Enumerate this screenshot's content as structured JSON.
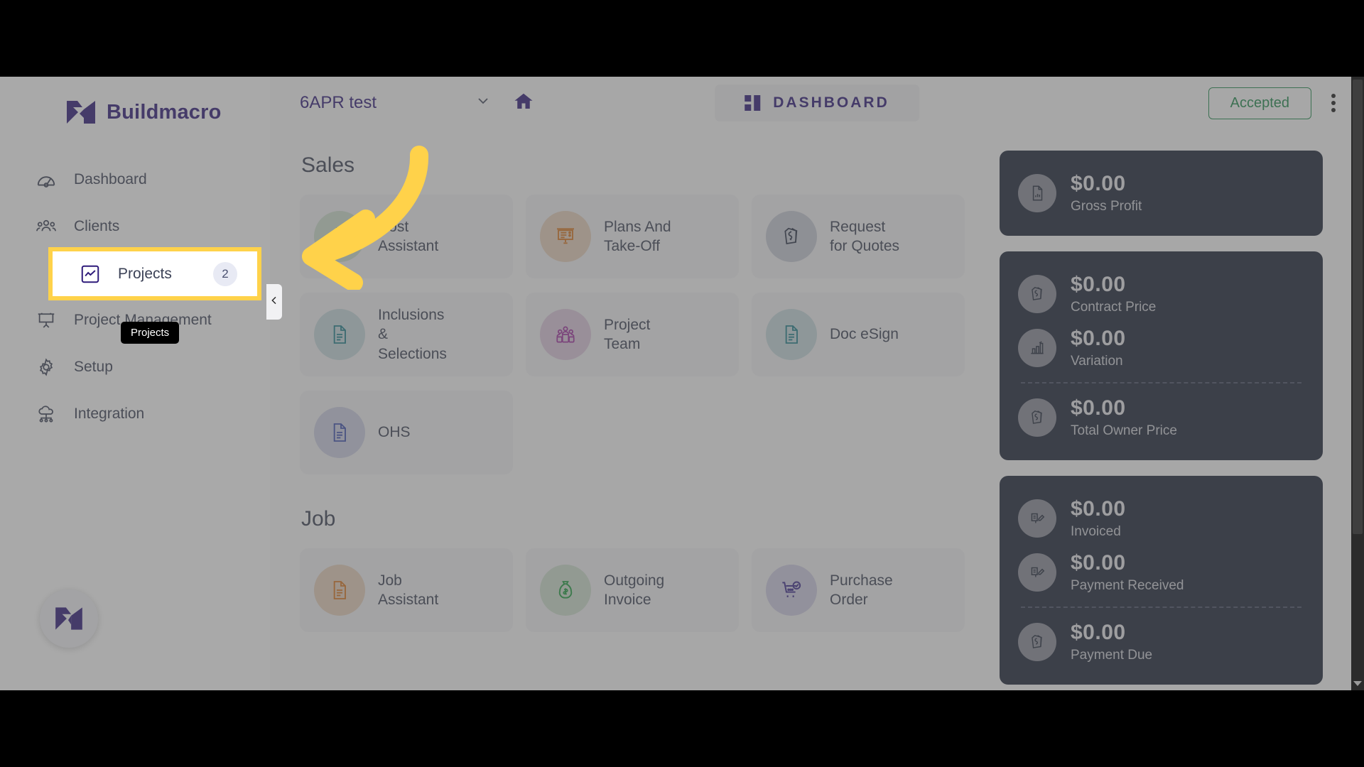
{
  "brand": {
    "name": "Buildmacro",
    "logo_icon": "buildmacro-logo-icon"
  },
  "sidebar": {
    "items": [
      {
        "label": "Dashboard",
        "icon": "speedometer-icon",
        "badge": ""
      },
      {
        "label": "Clients",
        "icon": "people-group-icon",
        "badge": ""
      },
      {
        "label": "Projects",
        "icon": "chart-square-icon",
        "badge": "2"
      },
      {
        "label": "Project Management",
        "icon": "presentation-board-icon",
        "badge": ""
      },
      {
        "label": "Setup",
        "icon": "gear-icon",
        "badge": ""
      },
      {
        "label": "Integration",
        "icon": "cloud-network-icon",
        "badge": ""
      }
    ],
    "tooltip": "Projects",
    "collapse_icon": "chevron-left-icon",
    "avatar_icon": "buildmacro-mark-icon",
    "highlight_color": "#ffd24a"
  },
  "header": {
    "project_name": "6APR test",
    "project_caret_icon": "chevron-down-icon",
    "home_icon": "home-icon",
    "dashboard_label": "DASHBOARD",
    "dashboard_icon": "grid-icon",
    "status_label": "Accepted",
    "status_color": "#1f8a4c",
    "more_icon": "kebab-menu-icon"
  },
  "sections": [
    {
      "title": "Sales",
      "tiles": [
        {
          "label": "Cost\nAssistant",
          "icon": "money-bag-icon",
          "icon_color": "#1f9d3f",
          "bg": "#cfe0cf"
        },
        {
          "label": "Plans And\nTake-Off",
          "icon": "presentation-icon",
          "icon_color": "#d9761f",
          "bg": "#e8d2bc"
        },
        {
          "label": "Request\nfor Quotes",
          "icon": "price-tag-icon",
          "icon_color": "#2b3347",
          "bg": "#c7cad6"
        },
        {
          "label": "Inclusions\n&\nSelections",
          "icon": "document-icon",
          "icon_color": "#1f7f8c",
          "bg": "#c6dadd"
        },
        {
          "label": "Project\nTeam",
          "icon": "team-icon",
          "icon_color": "#a02ea0",
          "bg": "#ddc8dd"
        },
        {
          "label": "Doc eSign",
          "icon": "document-icon",
          "icon_color": "#1f7f8c",
          "bg": "#c6dadd"
        },
        {
          "label": "OHS",
          "icon": "document-icon",
          "icon_color": "#3c4fb0",
          "bg": "#ccd0e4"
        }
      ]
    },
    {
      "title": "Job",
      "tiles": [
        {
          "label": "Job\nAssistant",
          "icon": "document-icon",
          "icon_color": "#d9761f",
          "bg": "#e8d2bc"
        },
        {
          "label": "Outgoing\nInvoice",
          "icon": "money-bag-icon",
          "icon_color": "#1f9d3f",
          "bg": "#cfe0cf"
        },
        {
          "label": "Purchase\nOrder",
          "icon": "cart-check-icon",
          "icon_color": "#3c2a8c",
          "bg": "#cfccE4"
        }
      ]
    }
  ],
  "summary": {
    "cards": [
      {
        "rows": [
          {
            "value": "$0.00",
            "label": "Gross Profit",
            "icon": "document-stats-icon",
            "separator_after": false
          }
        ]
      },
      {
        "rows": [
          {
            "value": "$0.00",
            "label": "Contract Price",
            "icon": "price-tag-icon",
            "separator_after": false
          },
          {
            "value": "$0.00",
            "label": "Variation",
            "icon": "bar-chart-icon",
            "separator_after": true
          },
          {
            "value": "$0.00",
            "label": "Total Owner Price",
            "icon": "price-tag-icon",
            "separator_after": false
          }
        ]
      },
      {
        "rows": [
          {
            "value": "$0.00",
            "label": "Invoiced",
            "icon": "invoice-edit-icon",
            "separator_after": false
          },
          {
            "value": "$0.00",
            "label": "Payment Received",
            "icon": "invoice-edit-icon",
            "separator_after": true
          },
          {
            "value": "$0.00",
            "label": "Payment Due",
            "icon": "price-tag-icon",
            "separator_after": false
          }
        ]
      }
    ]
  },
  "annotation": {
    "arrow_color": "#ffd24a",
    "arrow_icon": "curved-arrow-left-icon"
  }
}
